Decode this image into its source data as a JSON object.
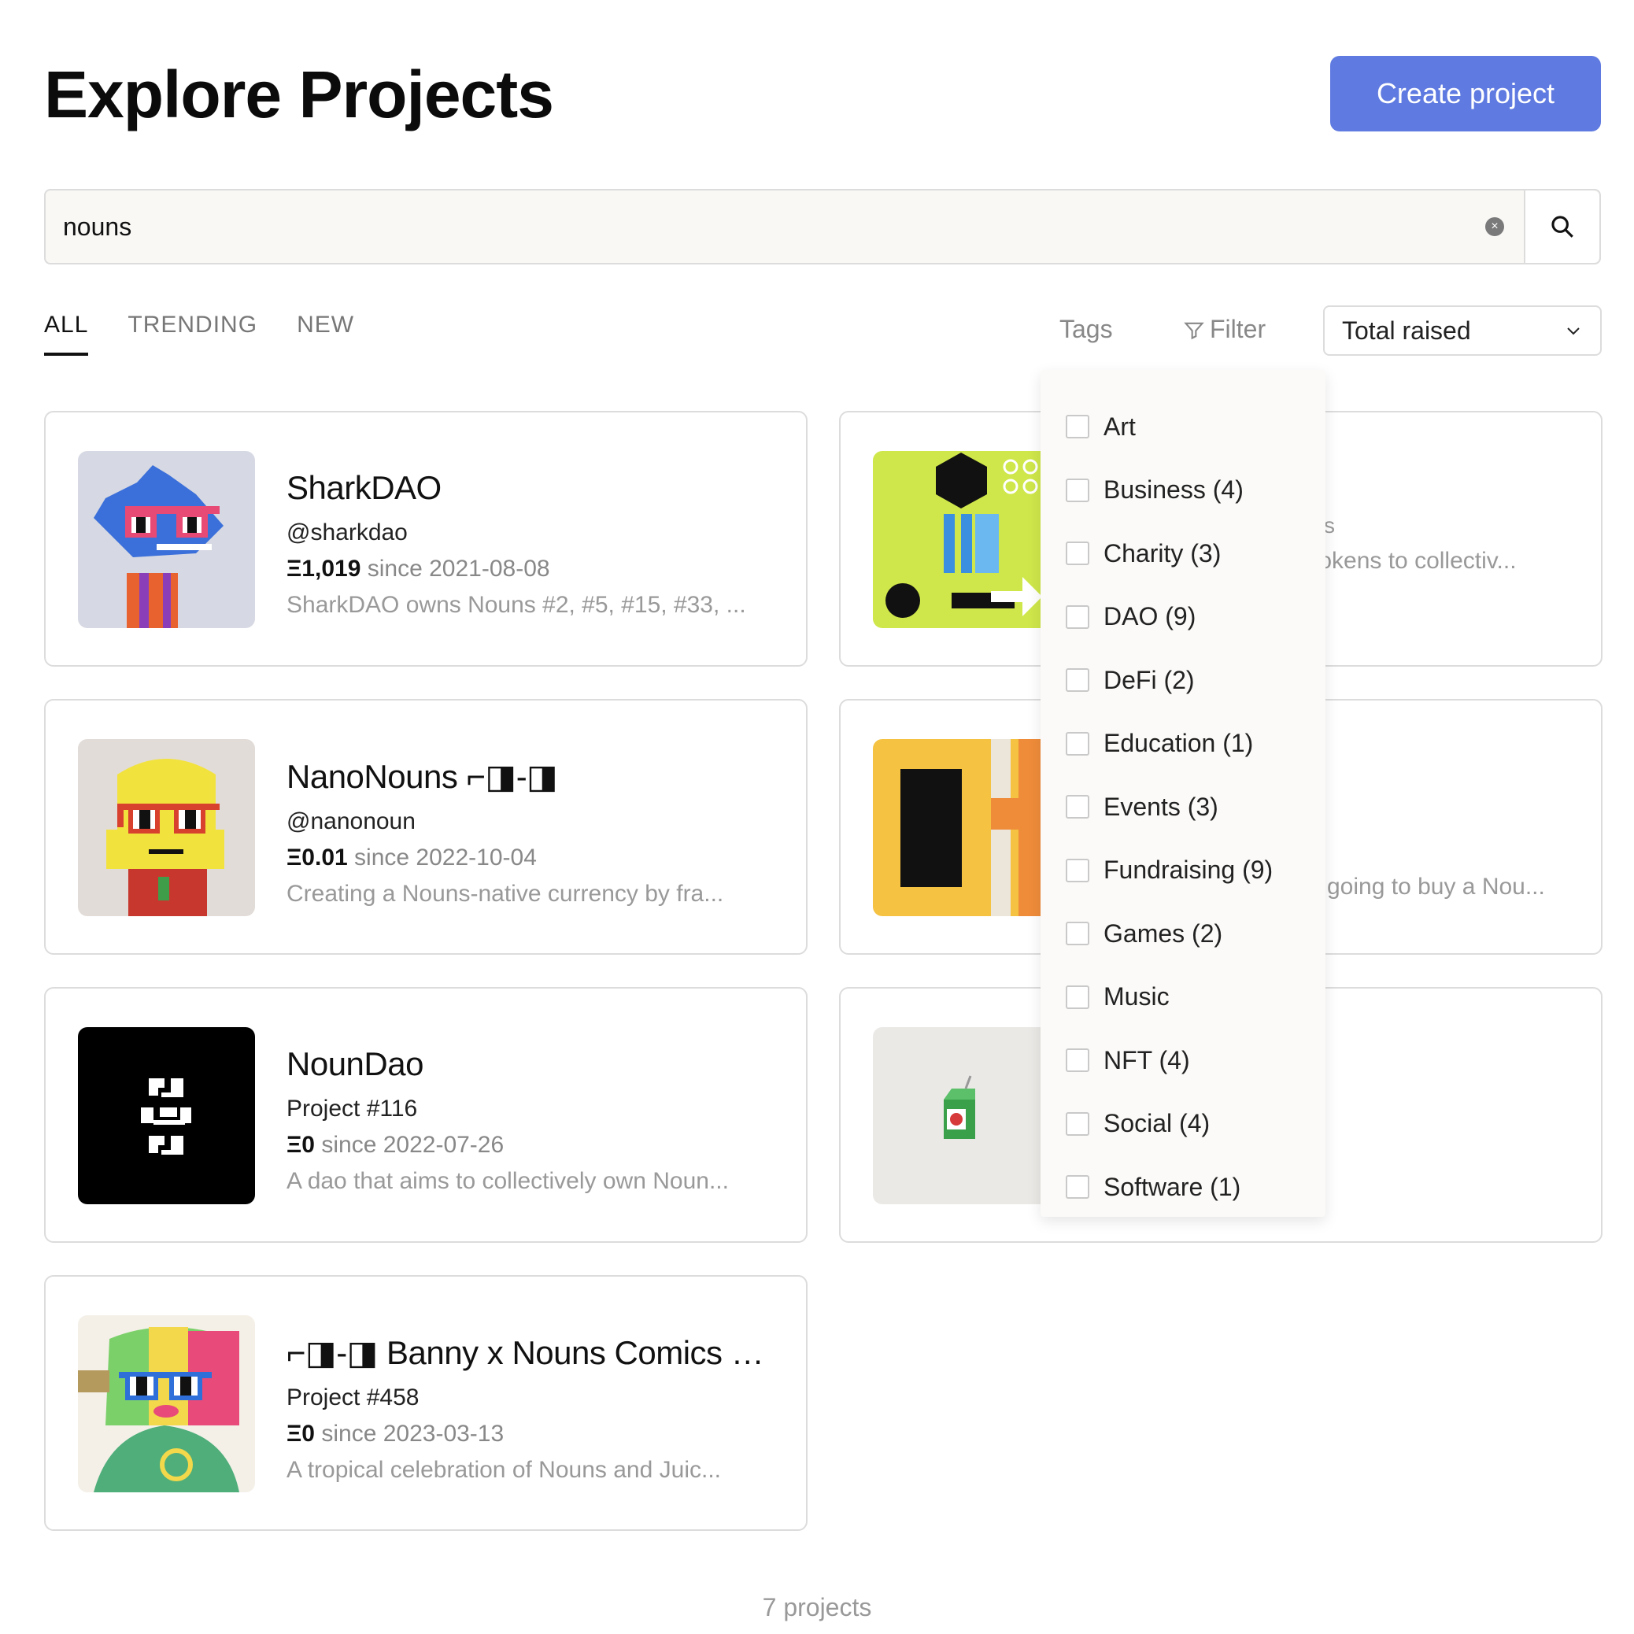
{
  "header": {
    "title": "Explore Projects",
    "create_label": "Create project"
  },
  "search": {
    "value": "nouns",
    "clear": "×"
  },
  "tabs": [
    {
      "label": "ALL"
    },
    {
      "label": "TRENDING"
    },
    {
      "label": "NEW"
    }
  ],
  "toolbar": {
    "tags_label": "Tags",
    "filter_label": "Filter",
    "sort_value": "Total raised"
  },
  "colors": {
    "accent": "#5f7ae0"
  },
  "projects": [
    {
      "name": "SharkDAO",
      "handle": "@sharkdao",
      "amount": "Ξ1,019",
      "since": "since 2021-08-08",
      "description": "SharkDAO owns Nouns #2, #5, #15, #33, ..."
    },
    {
      "partial_text": "tokens to collectiv...",
      "partial_glyph": "s"
    },
    {
      "name": "NanoNouns ⌐◨-◨",
      "handle": "@nanonoun",
      "amount": "Ξ0.01",
      "since": "since 2022-10-04",
      "description": "Creating a Nouns-native currency by fra..."
    },
    {
      "partial_text": "going to buy a Nou..."
    },
    {
      "name": "NounDao",
      "handle": "Project #116",
      "amount": "Ξ0",
      "since": "since 2022-07-26",
      "description": "A dao that aims to collectively own Noun..."
    },
    {},
    {
      "name": "⌐◨-◨ Banny x Nouns Comics NF...",
      "handle": "Project #458",
      "amount": "Ξ0",
      "since": "since 2023-03-13",
      "description": "A tropical celebration of Nouns and Juic..."
    }
  ],
  "tag_options": [
    {
      "label": "Art"
    },
    {
      "label": "Business (4)"
    },
    {
      "label": "Charity (3)"
    },
    {
      "label": "DAO (9)"
    },
    {
      "label": "DeFi (2)"
    },
    {
      "label": "Education (1)"
    },
    {
      "label": "Events (3)"
    },
    {
      "label": "Fundraising (9)"
    },
    {
      "label": "Games (2)"
    },
    {
      "label": "Music"
    },
    {
      "label": "NFT (4)"
    },
    {
      "label": "Social (4)"
    },
    {
      "label": "Software (1)"
    }
  ],
  "footer": {
    "count": "7 projects"
  }
}
